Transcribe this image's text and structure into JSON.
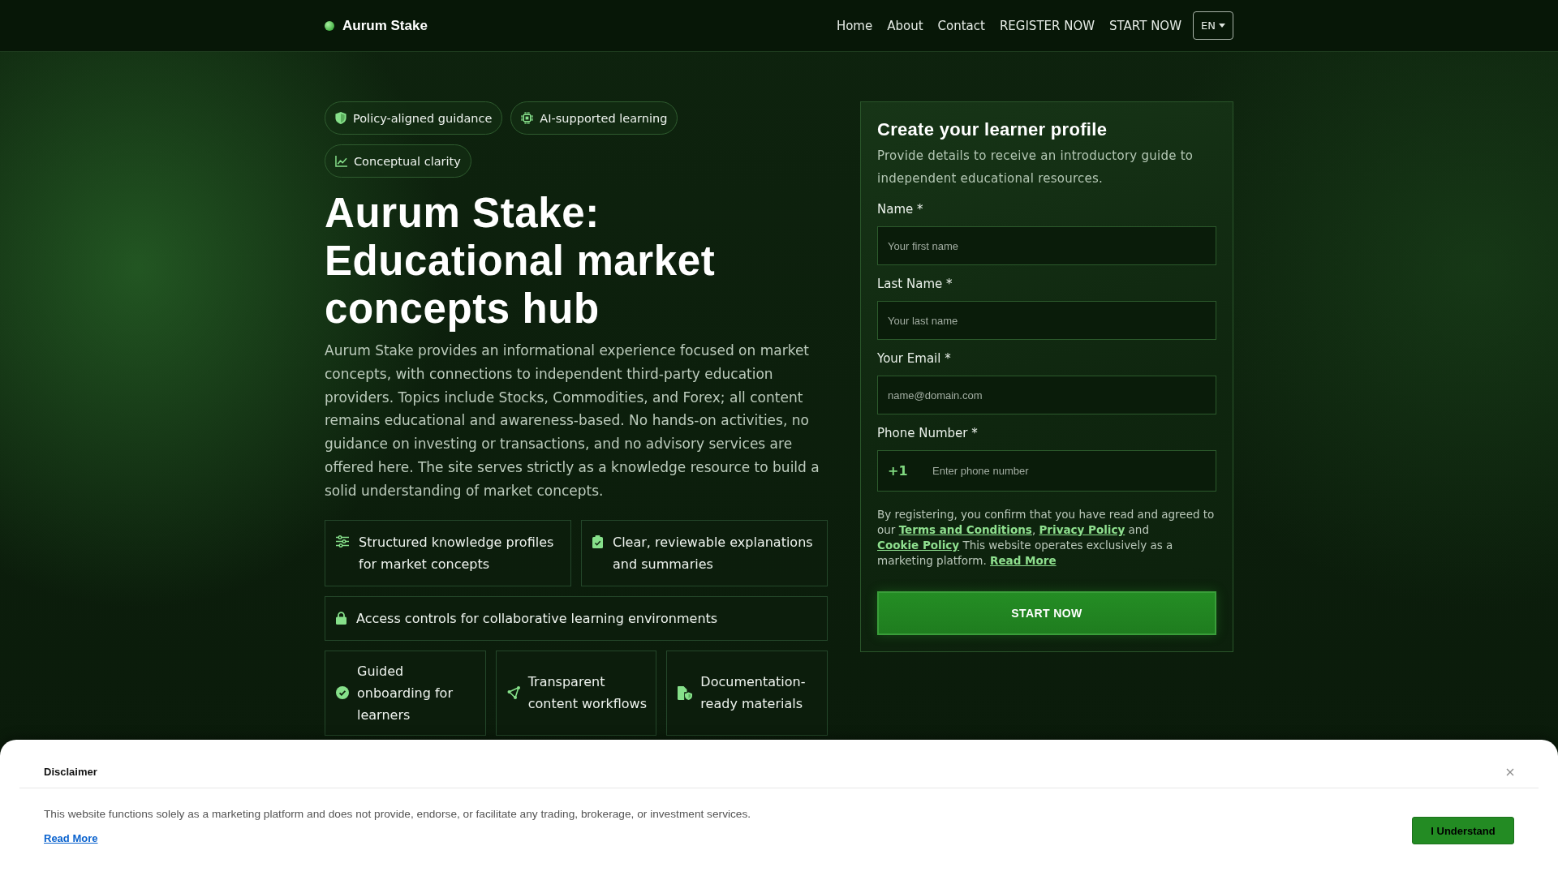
{
  "header": {
    "brand": "Aurum Stake",
    "nav": [
      "Home",
      "About",
      "Contact",
      "REGISTER NOW",
      "START NOW"
    ],
    "language": "EN"
  },
  "intro": {
    "badges": [
      "Policy-aligned guidance",
      "AI-supported learning",
      "Conceptual clarity"
    ],
    "title": "Aurum Stake: Educational market concepts hub",
    "text": "Aurum Stake provides an informational experience focused on market concepts, with connections to independent third-party education providers. Topics include Stocks, Commodities, and Forex; all content remains educational and awareness-based. No hands-on activities, no guidance on investing or transactions, and no advisory services are offered here. The site serves strictly as a knowledge resource to build a solid understanding of market concepts.",
    "feature_rows": [
      [
        "Structured knowledge profiles for market concepts",
        "Clear, reviewable explanations and summaries"
      ],
      [
        "Access controls for collaborative learning environments"
      ],
      [
        "Guided onboarding for learners",
        "Transparent content workflows",
        "Documentation-ready materials"
      ]
    ]
  },
  "form": {
    "title": "Create your learner profile",
    "subtitle": "Provide details to receive an introductory guide to independent educational resources.",
    "fields": [
      {
        "kind": "text",
        "label": "Name *",
        "placeholder": "Your first name"
      },
      {
        "kind": "text",
        "label": "Last Name *",
        "placeholder": "Your last name"
      },
      {
        "kind": "email",
        "label": "Your Email *",
        "placeholder": "name@domain.com"
      },
      {
        "kind": "phone",
        "label": "Phone Number *",
        "prefix": "+1",
        "placeholder": "Enter phone number"
      }
    ],
    "consent": [
      {
        "kind": "text",
        "text": "By registering, you confirm that you have read and agreed to our "
      },
      {
        "kind": "link",
        "text": "Terms and Conditions"
      },
      {
        "kind": "text",
        "text": ", "
      },
      {
        "kind": "link",
        "text": "Privacy Policy"
      },
      {
        "kind": "text",
        "text": " and "
      },
      {
        "kind": "link",
        "text": "Cookie Policy"
      },
      {
        "kind": "text",
        "text": " This website operates exclusively as a marketing platform. "
      },
      {
        "kind": "link",
        "text": "Read More"
      }
    ],
    "submit": "START NOW"
  },
  "disclaimer": {
    "title": "Disclaimer",
    "text": "This website functions solely as a marketing platform and does not provide, endorse, or facilitate any trading, brokerage, or investment services.",
    "link": "Read More",
    "button": "I Understand"
  }
}
